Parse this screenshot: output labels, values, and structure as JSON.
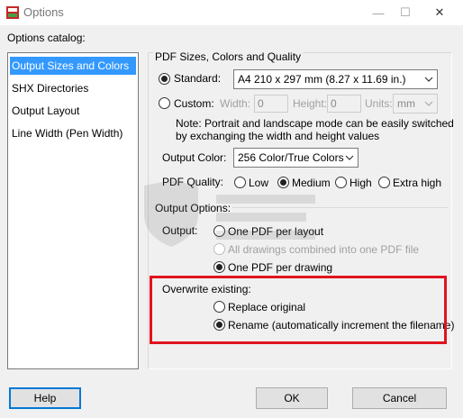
{
  "window": {
    "title": "Options",
    "minimize_glyph": "—",
    "maximize_glyph": "☐",
    "close_glyph": "✕"
  },
  "catalog": {
    "label": "Options catalog:",
    "items": [
      {
        "label": "Output Sizes and Colors",
        "selected": true
      },
      {
        "label": "SHX Directories",
        "selected": false
      },
      {
        "label": "Output Layout",
        "selected": false
      },
      {
        "label": "Line Width (Pen Width)",
        "selected": false
      }
    ]
  },
  "pdf_group": {
    "title": "PDF Sizes, Colors and Quality",
    "standard_label": "Standard:",
    "standard_value": "A4 210 x 297 mm (8.27 x 11.69 in.)",
    "custom_label": "Custom:",
    "width_label": "Width:",
    "width_value": "0",
    "height_label": "Height:",
    "height_value": "0",
    "units_label": "Units:",
    "units_value": "mm",
    "note_line1": "Note: Portrait and landscape mode can be easily switched",
    "note_line2": "by exchanging the width and height values",
    "output_color_label": "Output Color:",
    "output_color_value": "256 Color/True Colors",
    "quality_label": "PDF Quality:",
    "quality_options": [
      "Low",
      "Medium",
      "High",
      "Extra high"
    ],
    "quality_selected": "Medium"
  },
  "output_options": {
    "title": "Output Options:",
    "output_label": "Output:",
    "options": [
      "One PDF per layout",
      "All drawings combined into one PDF file",
      "One PDF per drawing"
    ],
    "selected": "One PDF per drawing"
  },
  "overwrite": {
    "label": "Overwrite existing:",
    "options": [
      "Replace original",
      "Rename (automatically increment the filename)"
    ],
    "selected": "Rename (automatically increment the filename)"
  },
  "buttons": {
    "help": "Help",
    "ok": "OK",
    "cancel": "Cancel"
  },
  "colors": {
    "selection": "#3399ff",
    "highlight": "#e0141e",
    "default_button_border": "#0078d7"
  }
}
